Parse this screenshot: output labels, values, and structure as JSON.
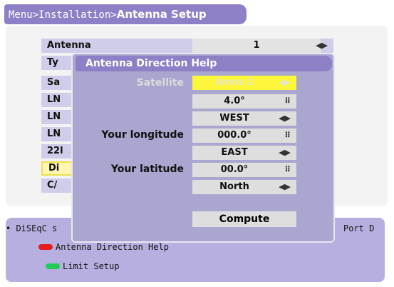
{
  "breadcrumb": {
    "path": "Menu>Installation>",
    "current": "Antenna Setup"
  },
  "menu": {
    "rows": [
      {
        "label": "Antenna",
        "value": "1",
        "arrows": "◀▶"
      },
      {
        "label": "Ty",
        "value": ""
      },
      {
        "label": "Sa",
        "value": ""
      },
      {
        "label": "LN",
        "value": ""
      },
      {
        "label": "LN",
        "value": ""
      },
      {
        "label": "LN",
        "value": ""
      },
      {
        "label": "22l",
        "value": ""
      },
      {
        "label": "Di",
        "value": ""
      },
      {
        "label": "C/",
        "value": ""
      }
    ]
  },
  "dialog": {
    "title": "Antenna Direction Help",
    "satellite_label": "Satellite",
    "satellite_value": "Amos 1",
    "sat_longitude": "4.0°",
    "sat_direction": "WEST",
    "your_longitude_label": "Your longitude",
    "your_longitude": "000.0°",
    "your_longitude_direction": "EAST",
    "your_latitude_label": "Your latitude",
    "your_latitude": "00.0°",
    "your_latitude_direction": "North",
    "compute_label": "Compute",
    "arrows": "◀▶",
    "keypad": "⠿"
  },
  "help": {
    "line1_left": "• DiSEqC s",
    "line1_right": "Port D",
    "red_label": "Antenna Direction Help",
    "green_label": "Limit Setup"
  },
  "colors": {
    "accent": "#8e7fc6",
    "red": "#e31d1d",
    "green": "#22cc55",
    "highlight": "#fdf63a"
  }
}
